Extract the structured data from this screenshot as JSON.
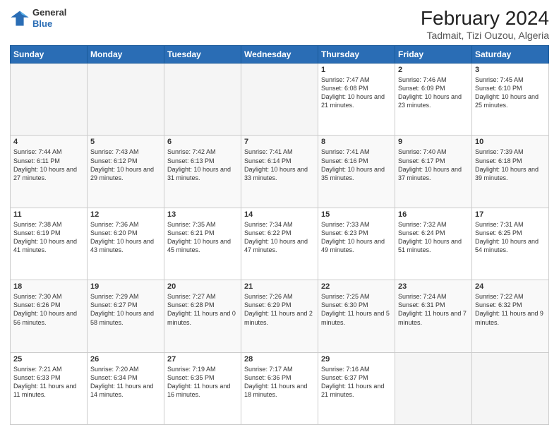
{
  "logo": {
    "general": "General",
    "blue": "Blue"
  },
  "header": {
    "title": "February 2024",
    "subtitle": "Tadmait, Tizi Ouzou, Algeria"
  },
  "weekdays": [
    "Sunday",
    "Monday",
    "Tuesday",
    "Wednesday",
    "Thursday",
    "Friday",
    "Saturday"
  ],
  "weeks": [
    [
      {
        "day": "",
        "info": ""
      },
      {
        "day": "",
        "info": ""
      },
      {
        "day": "",
        "info": ""
      },
      {
        "day": "",
        "info": ""
      },
      {
        "day": "1",
        "info": "Sunrise: 7:47 AM\nSunset: 6:08 PM\nDaylight: 10 hours and 21 minutes."
      },
      {
        "day": "2",
        "info": "Sunrise: 7:46 AM\nSunset: 6:09 PM\nDaylight: 10 hours and 23 minutes."
      },
      {
        "day": "3",
        "info": "Sunrise: 7:45 AM\nSunset: 6:10 PM\nDaylight: 10 hours and 25 minutes."
      }
    ],
    [
      {
        "day": "4",
        "info": "Sunrise: 7:44 AM\nSunset: 6:11 PM\nDaylight: 10 hours and 27 minutes."
      },
      {
        "day": "5",
        "info": "Sunrise: 7:43 AM\nSunset: 6:12 PM\nDaylight: 10 hours and 29 minutes."
      },
      {
        "day": "6",
        "info": "Sunrise: 7:42 AM\nSunset: 6:13 PM\nDaylight: 10 hours and 31 minutes."
      },
      {
        "day": "7",
        "info": "Sunrise: 7:41 AM\nSunset: 6:14 PM\nDaylight: 10 hours and 33 minutes."
      },
      {
        "day": "8",
        "info": "Sunrise: 7:41 AM\nSunset: 6:16 PM\nDaylight: 10 hours and 35 minutes."
      },
      {
        "day": "9",
        "info": "Sunrise: 7:40 AM\nSunset: 6:17 PM\nDaylight: 10 hours and 37 minutes."
      },
      {
        "day": "10",
        "info": "Sunrise: 7:39 AM\nSunset: 6:18 PM\nDaylight: 10 hours and 39 minutes."
      }
    ],
    [
      {
        "day": "11",
        "info": "Sunrise: 7:38 AM\nSunset: 6:19 PM\nDaylight: 10 hours and 41 minutes."
      },
      {
        "day": "12",
        "info": "Sunrise: 7:36 AM\nSunset: 6:20 PM\nDaylight: 10 hours and 43 minutes."
      },
      {
        "day": "13",
        "info": "Sunrise: 7:35 AM\nSunset: 6:21 PM\nDaylight: 10 hours and 45 minutes."
      },
      {
        "day": "14",
        "info": "Sunrise: 7:34 AM\nSunset: 6:22 PM\nDaylight: 10 hours and 47 minutes."
      },
      {
        "day": "15",
        "info": "Sunrise: 7:33 AM\nSunset: 6:23 PM\nDaylight: 10 hours and 49 minutes."
      },
      {
        "day": "16",
        "info": "Sunrise: 7:32 AM\nSunset: 6:24 PM\nDaylight: 10 hours and 51 minutes."
      },
      {
        "day": "17",
        "info": "Sunrise: 7:31 AM\nSunset: 6:25 PM\nDaylight: 10 hours and 54 minutes."
      }
    ],
    [
      {
        "day": "18",
        "info": "Sunrise: 7:30 AM\nSunset: 6:26 PM\nDaylight: 10 hours and 56 minutes."
      },
      {
        "day": "19",
        "info": "Sunrise: 7:29 AM\nSunset: 6:27 PM\nDaylight: 10 hours and 58 minutes."
      },
      {
        "day": "20",
        "info": "Sunrise: 7:27 AM\nSunset: 6:28 PM\nDaylight: 11 hours and 0 minutes."
      },
      {
        "day": "21",
        "info": "Sunrise: 7:26 AM\nSunset: 6:29 PM\nDaylight: 11 hours and 2 minutes."
      },
      {
        "day": "22",
        "info": "Sunrise: 7:25 AM\nSunset: 6:30 PM\nDaylight: 11 hours and 5 minutes."
      },
      {
        "day": "23",
        "info": "Sunrise: 7:24 AM\nSunset: 6:31 PM\nDaylight: 11 hours and 7 minutes."
      },
      {
        "day": "24",
        "info": "Sunrise: 7:22 AM\nSunset: 6:32 PM\nDaylight: 11 hours and 9 minutes."
      }
    ],
    [
      {
        "day": "25",
        "info": "Sunrise: 7:21 AM\nSunset: 6:33 PM\nDaylight: 11 hours and 11 minutes."
      },
      {
        "day": "26",
        "info": "Sunrise: 7:20 AM\nSunset: 6:34 PM\nDaylight: 11 hours and 14 minutes."
      },
      {
        "day": "27",
        "info": "Sunrise: 7:19 AM\nSunset: 6:35 PM\nDaylight: 11 hours and 16 minutes."
      },
      {
        "day": "28",
        "info": "Sunrise: 7:17 AM\nSunset: 6:36 PM\nDaylight: 11 hours and 18 minutes."
      },
      {
        "day": "29",
        "info": "Sunrise: 7:16 AM\nSunset: 6:37 PM\nDaylight: 11 hours and 21 minutes."
      },
      {
        "day": "",
        "info": ""
      },
      {
        "day": "",
        "info": ""
      }
    ]
  ]
}
